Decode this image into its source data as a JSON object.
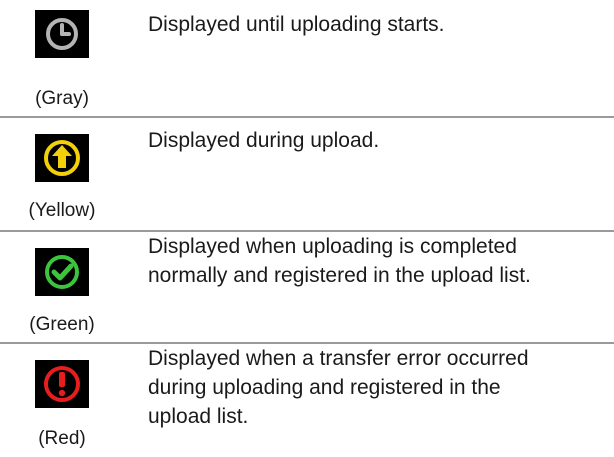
{
  "rows": [
    {
      "icon": "clock-icon",
      "icon_color": "#b4b4b4",
      "color_label": "(Gray)",
      "description_lines": [
        "Displayed until uploading starts."
      ]
    },
    {
      "icon": "upload-arrow-icon",
      "icon_color": "#f2d10a",
      "color_label": "(Yellow)",
      "description_lines": [
        "Displayed during upload."
      ]
    },
    {
      "icon": "checkmark-icon",
      "icon_color": "#3cc43c",
      "color_label": "(Green)",
      "description_lines": [
        "Displayed when uploading is completed",
        "normally and registered in the upload list."
      ]
    },
    {
      "icon": "exclamation-icon",
      "icon_color": "#e61e1e",
      "color_label": "(Red)",
      "description_lines": [
        "Displayed when a transfer error occurred",
        "during uploading and registered in the",
        "upload list."
      ]
    }
  ]
}
